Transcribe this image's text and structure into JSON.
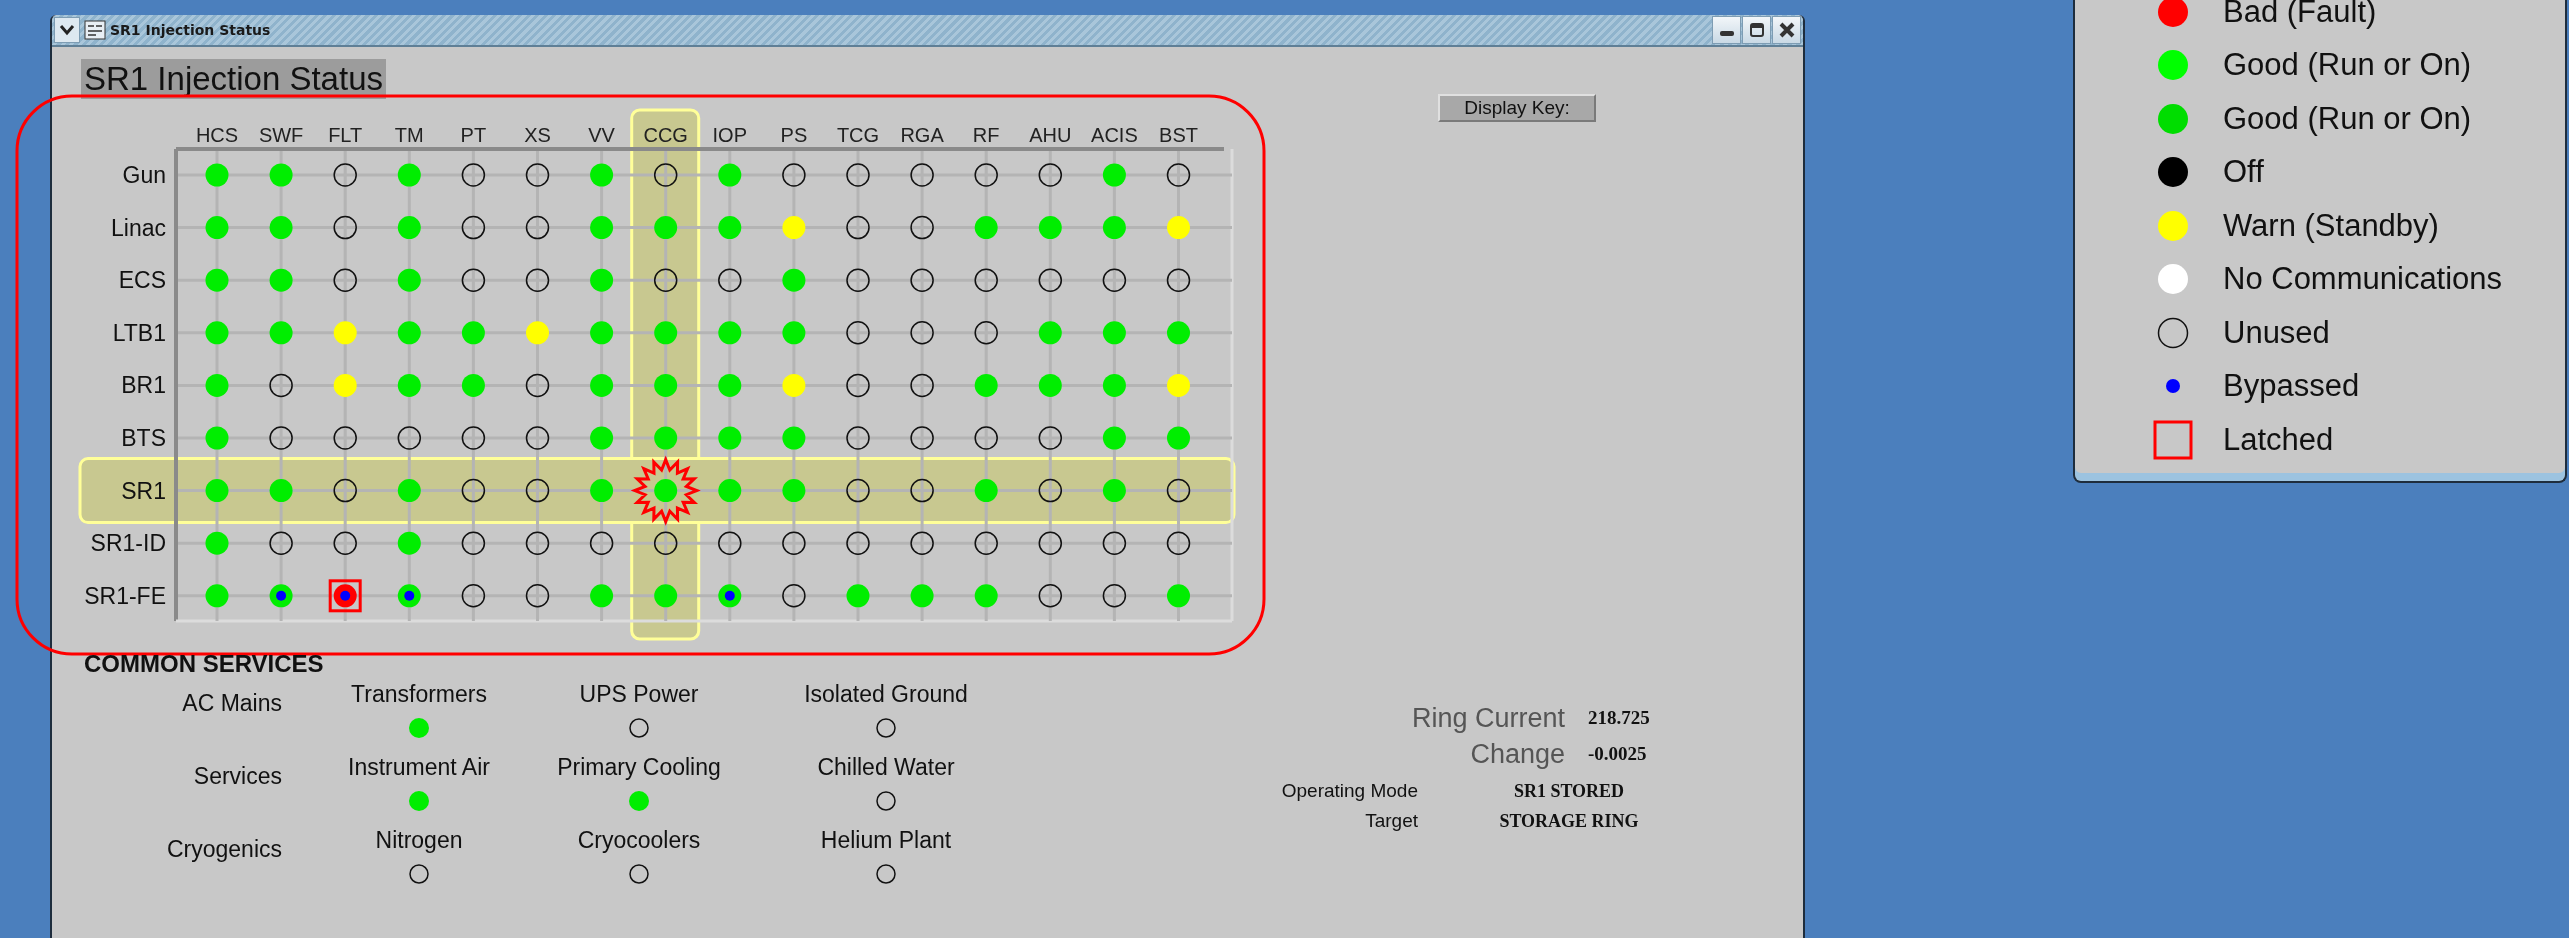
{
  "window": {
    "title": "SR1 Injection Status"
  },
  "heading": "SR1 Injection Status",
  "display_key_button": "Display Key:",
  "matrix": {
    "columns": [
      {
        "label": "HCS",
        "highlighted": false
      },
      {
        "label": "SWF",
        "highlighted": false
      },
      {
        "label": "FLT",
        "highlighted": false
      },
      {
        "label": "TM",
        "highlighted": false
      },
      {
        "label": "PT",
        "highlighted": false
      },
      {
        "label": "XS",
        "highlighted": false
      },
      {
        "label": "VV",
        "highlighted": false
      },
      {
        "label": "CCG",
        "highlighted": true
      },
      {
        "label": "IOP",
        "highlighted": false
      },
      {
        "label": "PS",
        "highlighted": false
      },
      {
        "label": "TCG",
        "highlighted": false
      },
      {
        "label": "RGA",
        "highlighted": false
      },
      {
        "label": "RF",
        "highlighted": false
      },
      {
        "label": "AHU",
        "highlighted": false
      },
      {
        "label": "ACIS",
        "highlighted": false
      },
      {
        "label": "BST",
        "highlighted": false
      }
    ],
    "rows": [
      {
        "label": "Gun",
        "highlighted": false,
        "cells": [
          {
            "kind": "dot",
            "color": "#00ee00",
            "bypassed": false,
            "latched": false
          },
          {
            "kind": "dot",
            "color": "#00ee00",
            "bypassed": false,
            "latched": false
          },
          {
            "kind": "ring",
            "bypassed": false,
            "latched": false
          },
          {
            "kind": "dot",
            "color": "#00ee00",
            "bypassed": false,
            "latched": false
          },
          {
            "kind": "ring",
            "bypassed": false,
            "latched": false
          },
          {
            "kind": "ring",
            "bypassed": false,
            "latched": false
          },
          {
            "kind": "dot",
            "color": "#00ee00",
            "bypassed": false,
            "latched": false
          },
          {
            "kind": "ring",
            "bypassed": false,
            "latched": false
          },
          {
            "kind": "dot",
            "color": "#00ee00",
            "bypassed": false,
            "latched": false
          },
          {
            "kind": "ring",
            "bypassed": false,
            "latched": false
          },
          {
            "kind": "ring",
            "bypassed": false,
            "latched": false
          },
          {
            "kind": "ring",
            "bypassed": false,
            "latched": false
          },
          {
            "kind": "ring",
            "bypassed": false,
            "latched": false
          },
          {
            "kind": "ring",
            "bypassed": false,
            "latched": false
          },
          {
            "kind": "dot",
            "color": "#00ee00",
            "bypassed": false,
            "latched": false
          },
          {
            "kind": "ring",
            "bypassed": false,
            "latched": false
          }
        ]
      },
      {
        "label": "Linac",
        "highlighted": false,
        "cells": [
          {
            "kind": "dot",
            "color": "#00ee00",
            "bypassed": false,
            "latched": false
          },
          {
            "kind": "dot",
            "color": "#00ee00",
            "bypassed": false,
            "latched": false
          },
          {
            "kind": "ring",
            "bypassed": false,
            "latched": false
          },
          {
            "kind": "dot",
            "color": "#00ee00",
            "bypassed": false,
            "latched": false
          },
          {
            "kind": "ring",
            "bypassed": false,
            "latched": false
          },
          {
            "kind": "ring",
            "bypassed": false,
            "latched": false
          },
          {
            "kind": "dot",
            "color": "#00ee00",
            "bypassed": false,
            "latched": false
          },
          {
            "kind": "dot",
            "color": "#00ee00",
            "bypassed": false,
            "latched": false
          },
          {
            "kind": "dot",
            "color": "#00ee00",
            "bypassed": false,
            "latched": false
          },
          {
            "kind": "dot",
            "color": "#ffff00",
            "bypassed": false,
            "latched": false
          },
          {
            "kind": "ring",
            "bypassed": false,
            "latched": false
          },
          {
            "kind": "ring",
            "bypassed": false,
            "latched": false
          },
          {
            "kind": "dot",
            "color": "#00ee00",
            "bypassed": false,
            "latched": false
          },
          {
            "kind": "dot",
            "color": "#00ee00",
            "bypassed": false,
            "latched": false
          },
          {
            "kind": "dot",
            "color": "#00ee00",
            "bypassed": false,
            "latched": false
          },
          {
            "kind": "dot",
            "color": "#ffff00",
            "bypassed": false,
            "latched": false
          }
        ]
      },
      {
        "label": "ECS",
        "highlighted": false,
        "cells": [
          {
            "kind": "dot",
            "color": "#00ee00",
            "bypassed": false,
            "latched": false
          },
          {
            "kind": "dot",
            "color": "#00ee00",
            "bypassed": false,
            "latched": false
          },
          {
            "kind": "ring",
            "bypassed": false,
            "latched": false
          },
          {
            "kind": "dot",
            "color": "#00ee00",
            "bypassed": false,
            "latched": false
          },
          {
            "kind": "ring",
            "bypassed": false,
            "latched": false
          },
          {
            "kind": "ring",
            "bypassed": false,
            "latched": false
          },
          {
            "kind": "dot",
            "color": "#00ee00",
            "bypassed": false,
            "latched": false
          },
          {
            "kind": "ring",
            "bypassed": false,
            "latched": false
          },
          {
            "kind": "ring",
            "bypassed": false,
            "latched": false
          },
          {
            "kind": "dot",
            "color": "#00ee00",
            "bypassed": false,
            "latched": false
          },
          {
            "kind": "ring",
            "bypassed": false,
            "latched": false
          },
          {
            "kind": "ring",
            "bypassed": false,
            "latched": false
          },
          {
            "kind": "ring",
            "bypassed": false,
            "latched": false
          },
          {
            "kind": "ring",
            "bypassed": false,
            "latched": false
          },
          {
            "kind": "ring",
            "bypassed": false,
            "latched": false
          },
          {
            "kind": "ring",
            "bypassed": false,
            "latched": false
          }
        ]
      },
      {
        "label": "LTB1",
        "highlighted": false,
        "cells": [
          {
            "kind": "dot",
            "color": "#00ee00",
            "bypassed": false,
            "latched": false
          },
          {
            "kind": "dot",
            "color": "#00ee00",
            "bypassed": false,
            "latched": false
          },
          {
            "kind": "dot",
            "color": "#ffff00",
            "bypassed": false,
            "latched": false
          },
          {
            "kind": "dot",
            "color": "#00ee00",
            "bypassed": false,
            "latched": false
          },
          {
            "kind": "dot",
            "color": "#00ee00",
            "bypassed": false,
            "latched": false
          },
          {
            "kind": "dot",
            "color": "#ffff00",
            "bypassed": false,
            "latched": false
          },
          {
            "kind": "dot",
            "color": "#00ee00",
            "bypassed": false,
            "latched": false
          },
          {
            "kind": "dot",
            "color": "#00ee00",
            "bypassed": false,
            "latched": false
          },
          {
            "kind": "dot",
            "color": "#00ee00",
            "bypassed": false,
            "latched": false
          },
          {
            "kind": "dot",
            "color": "#00ee00",
            "bypassed": false,
            "latched": false
          },
          {
            "kind": "ring",
            "bypassed": false,
            "latched": false
          },
          {
            "kind": "ring",
            "bypassed": false,
            "latched": false
          },
          {
            "kind": "ring",
            "bypassed": false,
            "latched": false
          },
          {
            "kind": "dot",
            "color": "#00ee00",
            "bypassed": false,
            "latched": false
          },
          {
            "kind": "dot",
            "color": "#00ee00",
            "bypassed": false,
            "latched": false
          },
          {
            "kind": "dot",
            "color": "#00ee00",
            "bypassed": false,
            "latched": false
          }
        ]
      },
      {
        "label": "BR1",
        "highlighted": false,
        "cells": [
          {
            "kind": "dot",
            "color": "#00ee00",
            "bypassed": false,
            "latched": false
          },
          {
            "kind": "ring",
            "bypassed": false,
            "latched": false
          },
          {
            "kind": "dot",
            "color": "#ffff00",
            "bypassed": false,
            "latched": false
          },
          {
            "kind": "dot",
            "color": "#00ee00",
            "bypassed": false,
            "latched": false
          },
          {
            "kind": "dot",
            "color": "#00ee00",
            "bypassed": false,
            "latched": false
          },
          {
            "kind": "ring",
            "bypassed": false,
            "latched": false
          },
          {
            "kind": "dot",
            "color": "#00ee00",
            "bypassed": false,
            "latched": false
          },
          {
            "kind": "dot",
            "color": "#00ee00",
            "bypassed": false,
            "latched": false
          },
          {
            "kind": "dot",
            "color": "#00ee00",
            "bypassed": false,
            "latched": false
          },
          {
            "kind": "dot",
            "color": "#ffff00",
            "bypassed": false,
            "latched": false
          },
          {
            "kind": "ring",
            "bypassed": false,
            "latched": false
          },
          {
            "kind": "ring",
            "bypassed": false,
            "latched": false
          },
          {
            "kind": "dot",
            "color": "#00ee00",
            "bypassed": false,
            "latched": false
          },
          {
            "kind": "dot",
            "color": "#00ee00",
            "bypassed": false,
            "latched": false
          },
          {
            "kind": "dot",
            "color": "#00ee00",
            "bypassed": false,
            "latched": false
          },
          {
            "kind": "dot",
            "color": "#ffff00",
            "bypassed": false,
            "latched": false
          }
        ]
      },
      {
        "label": "BTS",
        "highlighted": false,
        "cells": [
          {
            "kind": "dot",
            "color": "#00ee00",
            "bypassed": false,
            "latched": false
          },
          {
            "kind": "ring",
            "bypassed": false,
            "latched": false
          },
          {
            "kind": "ring",
            "bypassed": false,
            "latched": false
          },
          {
            "kind": "ring",
            "bypassed": false,
            "latched": false
          },
          {
            "kind": "ring",
            "bypassed": false,
            "latched": false
          },
          {
            "kind": "ring",
            "bypassed": false,
            "latched": false
          },
          {
            "kind": "dot",
            "color": "#00ee00",
            "bypassed": false,
            "latched": false
          },
          {
            "kind": "dot",
            "color": "#00ee00",
            "bypassed": false,
            "latched": false
          },
          {
            "kind": "dot",
            "color": "#00ee00",
            "bypassed": false,
            "latched": false
          },
          {
            "kind": "dot",
            "color": "#00ee00",
            "bypassed": false,
            "latched": false
          },
          {
            "kind": "ring",
            "bypassed": false,
            "latched": false
          },
          {
            "kind": "ring",
            "bypassed": false,
            "latched": false
          },
          {
            "kind": "ring",
            "bypassed": false,
            "latched": false
          },
          {
            "kind": "ring",
            "bypassed": false,
            "latched": false
          },
          {
            "kind": "dot",
            "color": "#00ee00",
            "bypassed": false,
            "latched": false
          },
          {
            "kind": "dot",
            "color": "#00ee00",
            "bypassed": false,
            "latched": false
          }
        ]
      },
      {
        "label": "SR1",
        "highlighted": true,
        "cells": [
          {
            "kind": "dot",
            "color": "#00ee00",
            "bypassed": false,
            "latched": false
          },
          {
            "kind": "dot",
            "color": "#00ee00",
            "bypassed": false,
            "latched": false
          },
          {
            "kind": "ring",
            "bypassed": false,
            "latched": false
          },
          {
            "kind": "dot",
            "color": "#00ee00",
            "bypassed": false,
            "latched": false
          },
          {
            "kind": "ring",
            "bypassed": false,
            "latched": false
          },
          {
            "kind": "ring",
            "bypassed": false,
            "latched": false
          },
          {
            "kind": "dot",
            "color": "#00ee00",
            "bypassed": false,
            "latched": false
          },
          {
            "kind": "dot",
            "color": "#00ee00",
            "bypassed": false,
            "latched": false
          },
          {
            "kind": "dot",
            "color": "#00ee00",
            "bypassed": false,
            "latched": false
          },
          {
            "kind": "dot",
            "color": "#00ee00",
            "bypassed": false,
            "latched": false
          },
          {
            "kind": "ring",
            "bypassed": false,
            "latched": false
          },
          {
            "kind": "ring",
            "bypassed": false,
            "latched": false
          },
          {
            "kind": "dot",
            "color": "#00ee00",
            "bypassed": false,
            "latched": false
          },
          {
            "kind": "ring",
            "bypassed": false,
            "latched": false
          },
          {
            "kind": "dot",
            "color": "#00ee00",
            "bypassed": false,
            "latched": false
          },
          {
            "kind": "ring",
            "bypassed": false,
            "latched": false
          }
        ]
      },
      {
        "label": "SR1-ID",
        "highlighted": false,
        "cells": [
          {
            "kind": "dot",
            "color": "#00ee00",
            "bypassed": false,
            "latched": false
          },
          {
            "kind": "ring",
            "bypassed": false,
            "latched": false
          },
          {
            "kind": "ring",
            "bypassed": false,
            "latched": false
          },
          {
            "kind": "dot",
            "color": "#00ee00",
            "bypassed": false,
            "latched": false
          },
          {
            "kind": "ring",
            "bypassed": false,
            "latched": false
          },
          {
            "kind": "ring",
            "bypassed": false,
            "latched": false
          },
          {
            "kind": "ring",
            "bypassed": false,
            "latched": false
          },
          {
            "kind": "ring",
            "bypassed": false,
            "latched": false
          },
          {
            "kind": "ring",
            "bypassed": false,
            "latched": false
          },
          {
            "kind": "ring",
            "bypassed": false,
            "latched": false
          },
          {
            "kind": "ring",
            "bypassed": false,
            "latched": false
          },
          {
            "kind": "ring",
            "bypassed": false,
            "latched": false
          },
          {
            "kind": "ring",
            "bypassed": false,
            "latched": false
          },
          {
            "kind": "ring",
            "bypassed": false,
            "latched": false
          },
          {
            "kind": "ring",
            "bypassed": false,
            "latched": false
          },
          {
            "kind": "ring",
            "bypassed": false,
            "latched": false
          }
        ]
      },
      {
        "label": "SR1-FE",
        "highlighted": false,
        "cells": [
          {
            "kind": "dot",
            "color": "#00ee00",
            "bypassed": false,
            "latched": false
          },
          {
            "kind": "dot",
            "color": "#00ee00",
            "bypassed": true,
            "latched": false
          },
          {
            "kind": "dot",
            "color": "#ff0000",
            "bypassed": true,
            "latched": true
          },
          {
            "kind": "dot",
            "color": "#00ee00",
            "bypassed": true,
            "latched": false
          },
          {
            "kind": "ring",
            "bypassed": false,
            "latched": false
          },
          {
            "kind": "ring",
            "bypassed": false,
            "latched": false
          },
          {
            "kind": "dot",
            "color": "#00ee00",
            "bypassed": false,
            "latched": false
          },
          {
            "kind": "dot",
            "color": "#00ee00",
            "bypassed": false,
            "latched": false
          },
          {
            "kind": "dot",
            "color": "#00ee00",
            "bypassed": true,
            "latched": false
          },
          {
            "kind": "ring",
            "bypassed": false,
            "latched": false
          },
          {
            "kind": "dot",
            "color": "#00ee00",
            "bypassed": false,
            "latched": false
          },
          {
            "kind": "dot",
            "color": "#00ee00",
            "bypassed": false,
            "latched": false
          },
          {
            "kind": "dot",
            "color": "#00ee00",
            "bypassed": false,
            "latched": false
          },
          {
            "kind": "ring",
            "bypassed": false,
            "latched": false
          },
          {
            "kind": "ring",
            "bypassed": false,
            "latched": false
          },
          {
            "kind": "dot",
            "color": "#00ee00",
            "bypassed": false,
            "latched": false
          }
        ]
      }
    ]
  },
  "common_services": {
    "title": "COMMON SERVICES",
    "groups": [
      {
        "label": "AC Mains",
        "items": [
          {
            "label": "Transformers",
            "kind": "dot",
            "color": "#00ee00"
          },
          {
            "label": "UPS Power",
            "kind": "ring"
          },
          {
            "label": "Isolated Ground",
            "kind": "ring"
          }
        ]
      },
      {
        "label": "Services",
        "items": [
          {
            "label": "Instrument Air",
            "kind": "dot",
            "color": "#00ee00"
          },
          {
            "label": "Primary Cooling",
            "kind": "dot",
            "color": "#00ee00"
          },
          {
            "label": "Chilled Water",
            "kind": "ring"
          }
        ]
      },
      {
        "label": "Cryogenics",
        "items": [
          {
            "label": "Nitrogen",
            "kind": "ring"
          },
          {
            "label": "Cryocoolers",
            "kind": "ring"
          },
          {
            "label": "Helium Plant",
            "kind": "ring"
          }
        ]
      }
    ]
  },
  "ring_info": [
    {
      "label": "Ring Current",
      "value": "218.725"
    },
    {
      "label": "Change",
      "value": "-0.0025"
    }
  ],
  "mode_info": [
    {
      "label": "Operating Mode",
      "value": "SR1 STORED"
    },
    {
      "label": "Target",
      "value": "STORAGE RING"
    }
  ],
  "legend": [
    {
      "kind": "dot",
      "color": "#ff0000",
      "label": "Bad (Fault)"
    },
    {
      "kind": "dot",
      "color": "#00ff00",
      "label": "Good (Run or On)"
    },
    {
      "kind": "dot",
      "color": "#00dd00",
      "label": "Good (Run or On)"
    },
    {
      "kind": "dot",
      "color": "#000000",
      "label": "Off"
    },
    {
      "kind": "dot",
      "color": "#ffff00",
      "label": "Warn (Standby)"
    },
    {
      "kind": "dot",
      "color": "#ffffff",
      "label": "No Communications"
    },
    {
      "kind": "ring",
      "label": "Unused"
    },
    {
      "kind": "bypass",
      "label": "Bypassed"
    },
    {
      "kind": "latched",
      "label": "Latched"
    }
  ]
}
